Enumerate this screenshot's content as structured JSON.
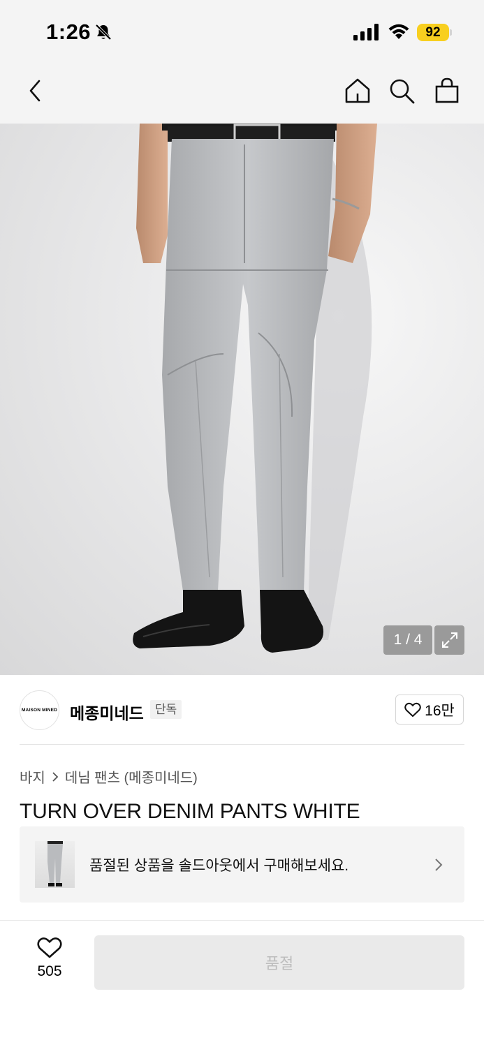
{
  "status_bar": {
    "time": "1:26",
    "battery": "92",
    "icons": [
      "bell-slash-icon",
      "cellular-signal-icon",
      "wifi-icon",
      "battery-icon"
    ]
  },
  "nav": {
    "icons": [
      "back-chevron-icon",
      "home-icon",
      "search-icon",
      "shopping-bag-icon"
    ]
  },
  "gallery": {
    "counter": "1 / 4",
    "expand_icon": "expand-icon"
  },
  "brand": {
    "logo_text": "MAISON MINED",
    "name": "메종미네드",
    "badge": "단독",
    "like_count": "16만"
  },
  "product": {
    "breadcrumb": [
      "바지",
      "데님 팬츠 (메종미네드)"
    ],
    "title": "TURN OVER DENIM PANTS WHITE"
  },
  "soldout_banner": {
    "text": "품절된 상품을 솔드아웃에서 구매해보세요."
  },
  "bottom_bar": {
    "wish_count": "505",
    "buy_label": "품절"
  },
  "colors": {
    "battery": "#f8cf1f",
    "denim": "#b8babd",
    "background_bar": "#f4f4f4"
  }
}
